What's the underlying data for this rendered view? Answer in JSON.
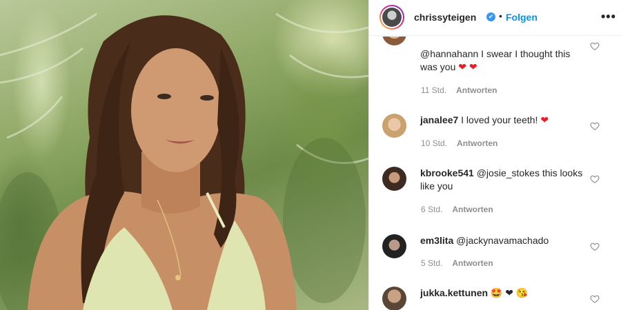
{
  "header": {
    "username": "chrissyteigen",
    "verified_glyph": "✔",
    "separator": "•",
    "follow_label": "Folgen",
    "more_label": "•••"
  },
  "comments": [
    {
      "user": "",
      "text": "@hannahann I swear I thought this was you",
      "emoji": "❤ ❤",
      "time": "11 Std.",
      "reply_label": "Antworten"
    },
    {
      "user": "janalee7",
      "text": "I loved your teeth!",
      "emoji": "❤",
      "time": "10 Std.",
      "reply_label": "Antworten"
    },
    {
      "user": "kbrooke541",
      "text": "@josie_stokes this looks like you",
      "emoji": "",
      "time": "6 Std.",
      "reply_label": "Antworten"
    },
    {
      "user": "em3lita",
      "text": "@jackynavamachado",
      "emoji": "",
      "time": "5 Std.",
      "reply_label": "Antworten"
    },
    {
      "user": "jukka.kettunen",
      "text": "",
      "emoji": "🤩 ❤ 😘",
      "time": "",
      "reply_label": ""
    }
  ],
  "icons": {
    "heart": "heart-outline-icon",
    "verified": "verified-badge-icon",
    "more": "more-options-icon"
  },
  "colors": {
    "follow": "#0095f6",
    "verified": "#3897f0",
    "text": "#262626",
    "meta": "#8e8e8e",
    "heart_emoji": "#ed1c24"
  }
}
